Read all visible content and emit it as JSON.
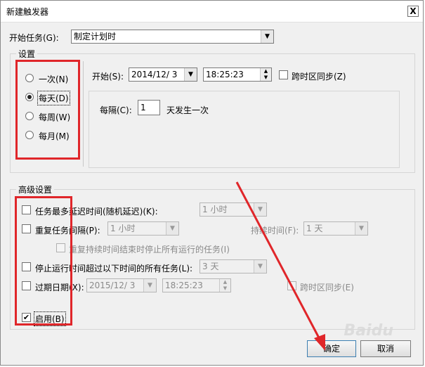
{
  "window": {
    "title": "新建触发器",
    "close_label": "X"
  },
  "begin_task": {
    "label": "开始任务(G):",
    "value": "制定计划时"
  },
  "settings": {
    "legend": "设置",
    "options": [
      {
        "label": "一次(N)",
        "checked": false
      },
      {
        "label": "每天(D)",
        "checked": true
      },
      {
        "label": "每周(W)",
        "checked": false
      },
      {
        "label": "每月(M)",
        "checked": false
      }
    ],
    "start_label": "开始(S):",
    "start_date": "2014/12/  3",
    "start_time": "18:25:23",
    "sync_label": "跨时区同步(Z)",
    "every_label": "每隔(C):",
    "every_value": "1",
    "every_suffix": "天发生一次"
  },
  "advanced": {
    "legend": "高级设置",
    "delay_label": "任务最多延迟时间(随机延迟)(K):",
    "delay_value": "1 小时",
    "repeat_label": "重复任务间隔(P):",
    "repeat_value": "1 小时",
    "duration_label": "持续时间(F):",
    "duration_value": "1 天",
    "stop_all_label": "重复持续时间结束时停止所有运行的任务(I)",
    "stop_running_label": "停止运行时间超过以下时间的所有任务(L):",
    "stop_running_value": "3 天",
    "expire_label": "过期日期(X):",
    "expire_date": "2015/12/  3",
    "expire_time": "18:25:23",
    "expire_sync_label": "跨时区同步(E)",
    "enabled_label": "启用(B)"
  },
  "buttons": {
    "ok": "确定",
    "cancel": "取消"
  },
  "watermark": "Baidu"
}
